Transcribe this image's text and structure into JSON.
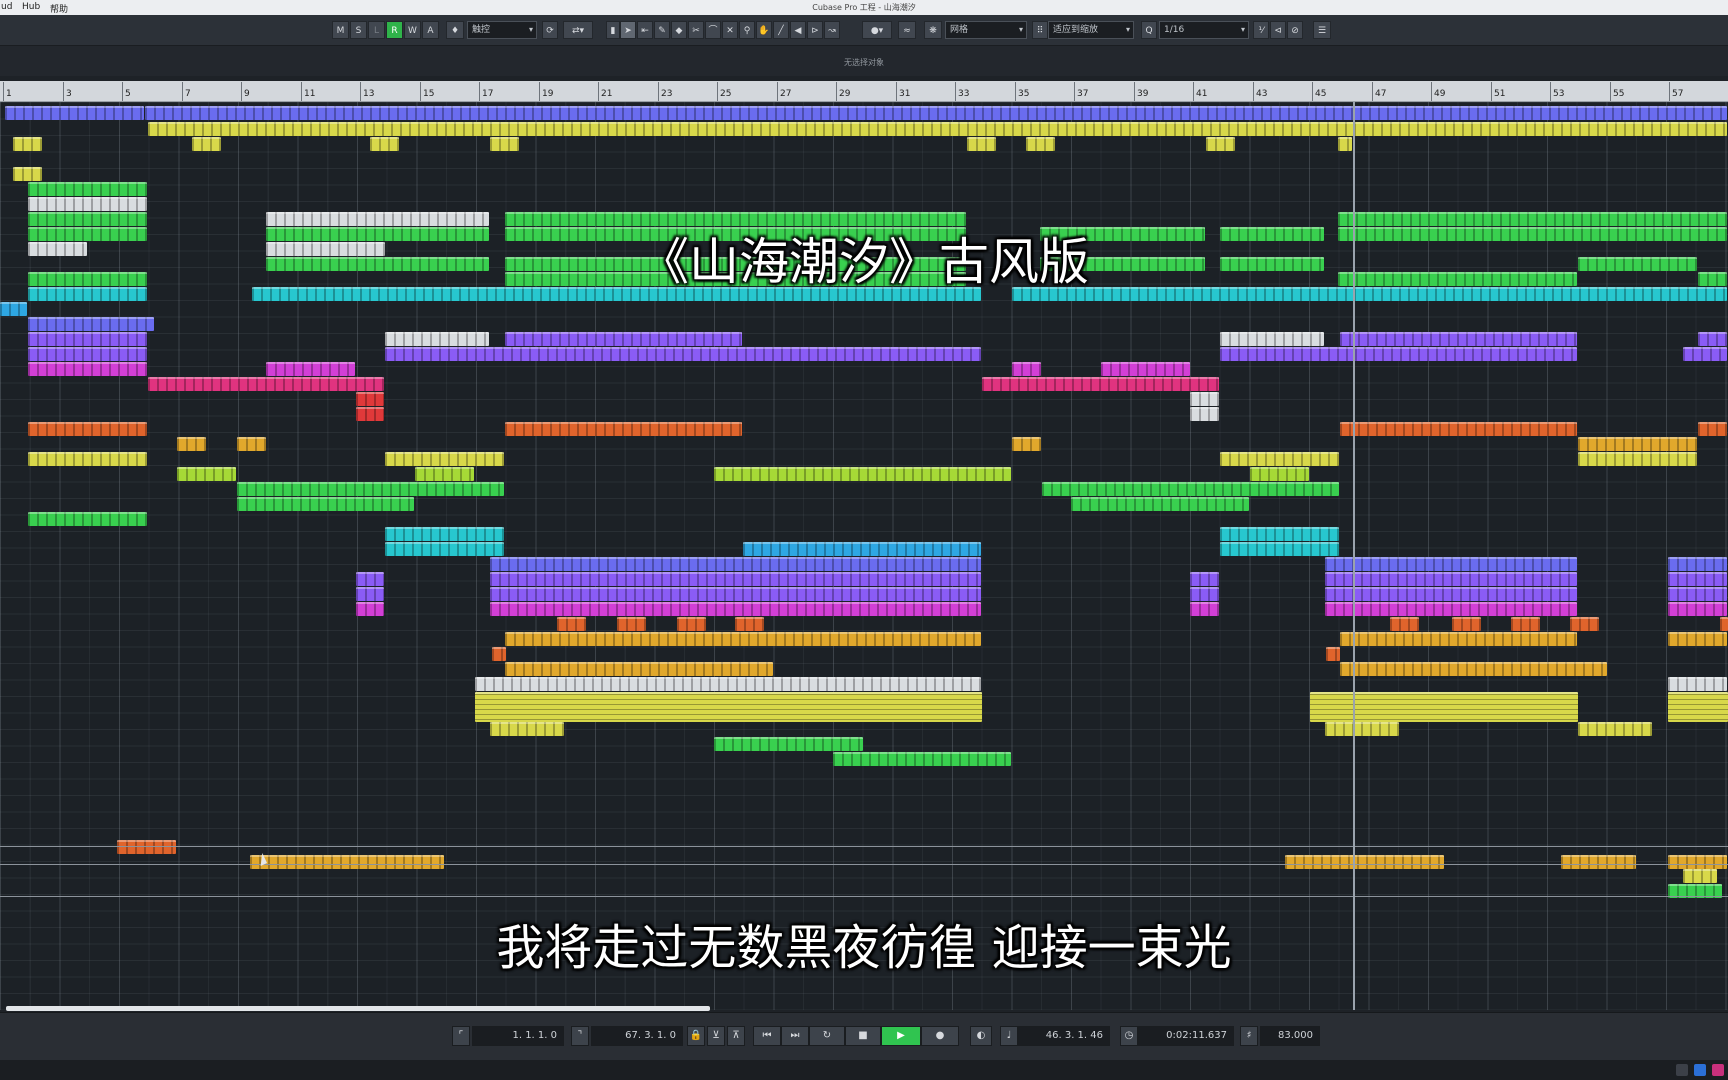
{
  "menu": {
    "items": [
      "ud",
      "Hub",
      "帮助"
    ],
    "window_title": "Cubase Pro 工程 - 山海潮汐"
  },
  "toolbar": {
    "mode_buttons": [
      "M",
      "S",
      "L",
      "R",
      "W",
      "A"
    ],
    "automation_mode": "触控",
    "snap_type": "网格",
    "grid_mode": "适应到缩放",
    "quantize": "1/16"
  },
  "info_line": "无选择对象",
  "ruler": {
    "bars": [
      "1",
      "3",
      "5",
      "7",
      "9",
      "11",
      "13",
      "15",
      "17",
      "19",
      "21",
      "23",
      "25",
      "27",
      "29",
      "31",
      "33",
      "35",
      "37",
      "39",
      "41",
      "43",
      "45",
      "47",
      "49",
      "51",
      "53",
      "55",
      "57"
    ]
  },
  "overlay": {
    "video_title": "《山海潮汐》古风版",
    "subtitle": "我将走过无数黑夜彷徨 迎接一束光"
  },
  "transport": {
    "left_locator": "1. 1. 1.   0",
    "right_locator": "67. 3. 1.   0",
    "position_bars": "46. 3. 1. 46",
    "position_time": "0:02:11.637",
    "tempo": "83.000"
  },
  "colors": {
    "lane_blue": "#6a6cf0",
    "yellow": "#d8d84a",
    "green": "#39d04f",
    "white": "#d9dde0",
    "cyan": "#27c7cf",
    "violet": "#8a5cf5",
    "magenta": "#d23fd6",
    "pink": "#e0337f",
    "red": "#e0393a",
    "orange": "#e0642c",
    "lime": "#a6d936",
    "sky": "#2ea7e3",
    "gold": "#e1a82c"
  }
}
